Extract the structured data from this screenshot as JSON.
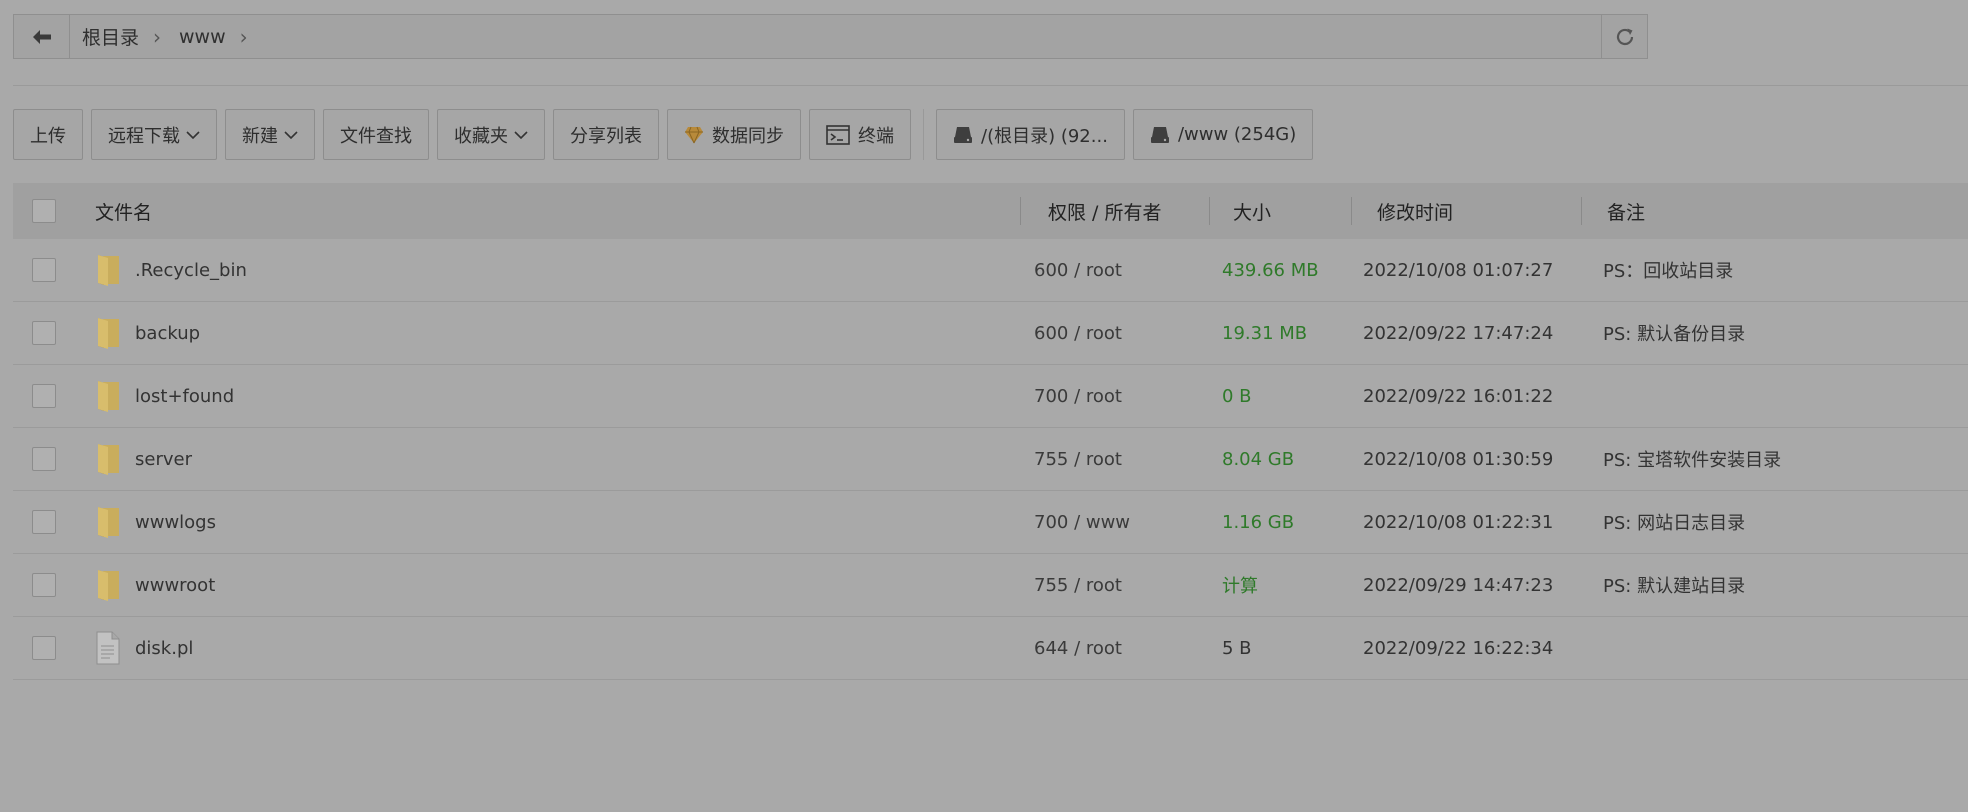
{
  "breadcrumb": {
    "items": [
      "根目录",
      "www"
    ]
  },
  "toolbar": {
    "upload": "上传",
    "remote_download": "远程下载",
    "new": "新建",
    "file_search": "文件查找",
    "favorites": "收藏夹",
    "share_list": "分享列表",
    "data_sync": "数据同步",
    "terminal": "终端",
    "disk_root": "/(根目录) (92...",
    "disk_www": "/www (254G)"
  },
  "table": {
    "headers": {
      "name": "文件名",
      "perm": "权限 / 所有者",
      "size": "大小",
      "mtime": "修改时间",
      "note": "备注"
    },
    "rows": [
      {
        "name": ".Recycle_bin",
        "type": "folder",
        "perm": "600 / root",
        "size": "439.66 MB",
        "mtime": "2022/10/08 01:07:27",
        "note": "PS：回收站目录"
      },
      {
        "name": "backup",
        "type": "folder",
        "perm": "600 / root",
        "size": "19.31 MB",
        "mtime": "2022/09/22 17:47:24",
        "note": "PS: 默认备份目录"
      },
      {
        "name": "lost+found",
        "type": "folder",
        "perm": "700 / root",
        "size": "0 B",
        "mtime": "2022/09/22 16:01:22",
        "note": ""
      },
      {
        "name": "server",
        "type": "folder",
        "perm": "755 / root",
        "size": "8.04 GB",
        "mtime": "2022/10/08 01:30:59",
        "note": "PS: 宝塔软件安装目录"
      },
      {
        "name": "wwwlogs",
        "type": "folder",
        "perm": "700 / www",
        "size": "1.16 GB",
        "mtime": "2022/10/08 01:22:31",
        "note": "PS: 网站日志目录"
      },
      {
        "name": "wwwroot",
        "type": "folder",
        "perm": "755 / root",
        "size": "计算",
        "mtime": "2022/09/29 14:47:23",
        "note": "PS: 默认建站目录"
      },
      {
        "name": "disk.pl",
        "type": "file",
        "perm": "644 / root",
        "size": "5 B",
        "mtime": "2022/09/22 16:22:34",
        "note": ""
      }
    ]
  },
  "colors": {
    "size_green": "#2f7a2a",
    "folder": "#c9ad5d"
  }
}
